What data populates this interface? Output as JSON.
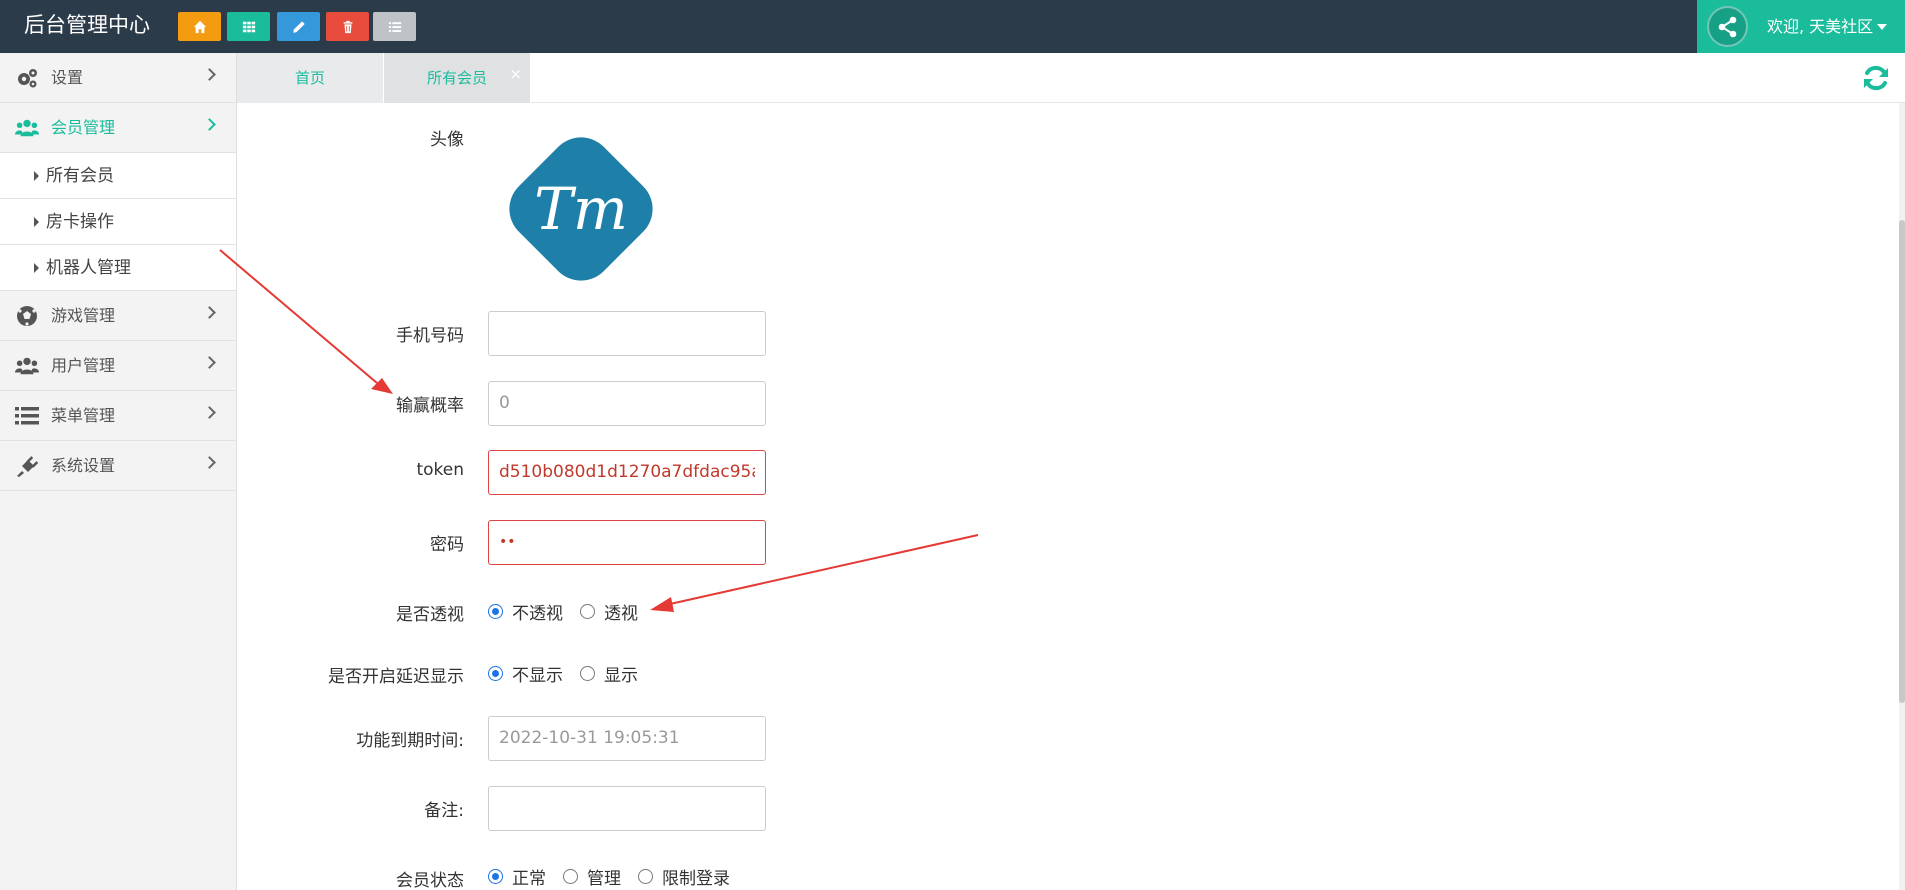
{
  "app": {
    "title": "后台管理中心"
  },
  "toolbar": {
    "buttons": [
      {
        "icon": "home-icon",
        "color": "#f39c12"
      },
      {
        "icon": "grid-icon",
        "color": "#1abc9c"
      },
      {
        "icon": "pencil-icon",
        "color": "#3498db"
      },
      {
        "icon": "trash-icon",
        "color": "#e74c3c"
      },
      {
        "icon": "list-icon",
        "color": "#bdc3c7"
      }
    ]
  },
  "user": {
    "welcome": "欢迎, 天美社区"
  },
  "sidebar": {
    "items": [
      {
        "label": "设置",
        "icon": "gears-icon"
      },
      {
        "label": "会员管理",
        "icon": "users-icon"
      },
      {
        "label": "游戏管理",
        "icon": "soccer-ball-icon"
      },
      {
        "label": "用户管理",
        "icon": "group-icon"
      },
      {
        "label": "菜单管理",
        "icon": "list-icon"
      },
      {
        "label": "系统设置",
        "icon": "plug-icon"
      }
    ],
    "sub_items": [
      {
        "label": "所有会员"
      },
      {
        "label": "房卡操作"
      },
      {
        "label": "机器人管理"
      }
    ]
  },
  "tabs": [
    {
      "label": "首页"
    },
    {
      "label": "所有会员",
      "close": "×"
    }
  ],
  "form": {
    "avatar_label": "头像",
    "avatar_text": "Tm",
    "phone_label": "手机号码",
    "phone_value": "",
    "win_rate_label": "输赢概率",
    "win_rate_placeholder": "0",
    "token_label": "token",
    "token_value": "d510b080d1d1270a7dfdac95a",
    "password_label": "密码",
    "password_value": "••",
    "seethrough_label": "是否透视",
    "seethrough_options": [
      "不透视",
      "透视"
    ],
    "delay_label": "是否开启延迟显示",
    "delay_options": [
      "不显示",
      "显示"
    ],
    "expire_label": "功能到期时间:",
    "expire_value": "2022-10-31 19:05:31",
    "note_label": "备注:",
    "note_value": "",
    "status_label": "会员状态",
    "status_options": [
      "正常",
      "管理",
      "限制登录"
    ]
  },
  "colors": {
    "accent": "#1abc9c",
    "topbar": "#2c3b4a",
    "annotation": "#e53935",
    "logo": "#1e7fa8"
  }
}
